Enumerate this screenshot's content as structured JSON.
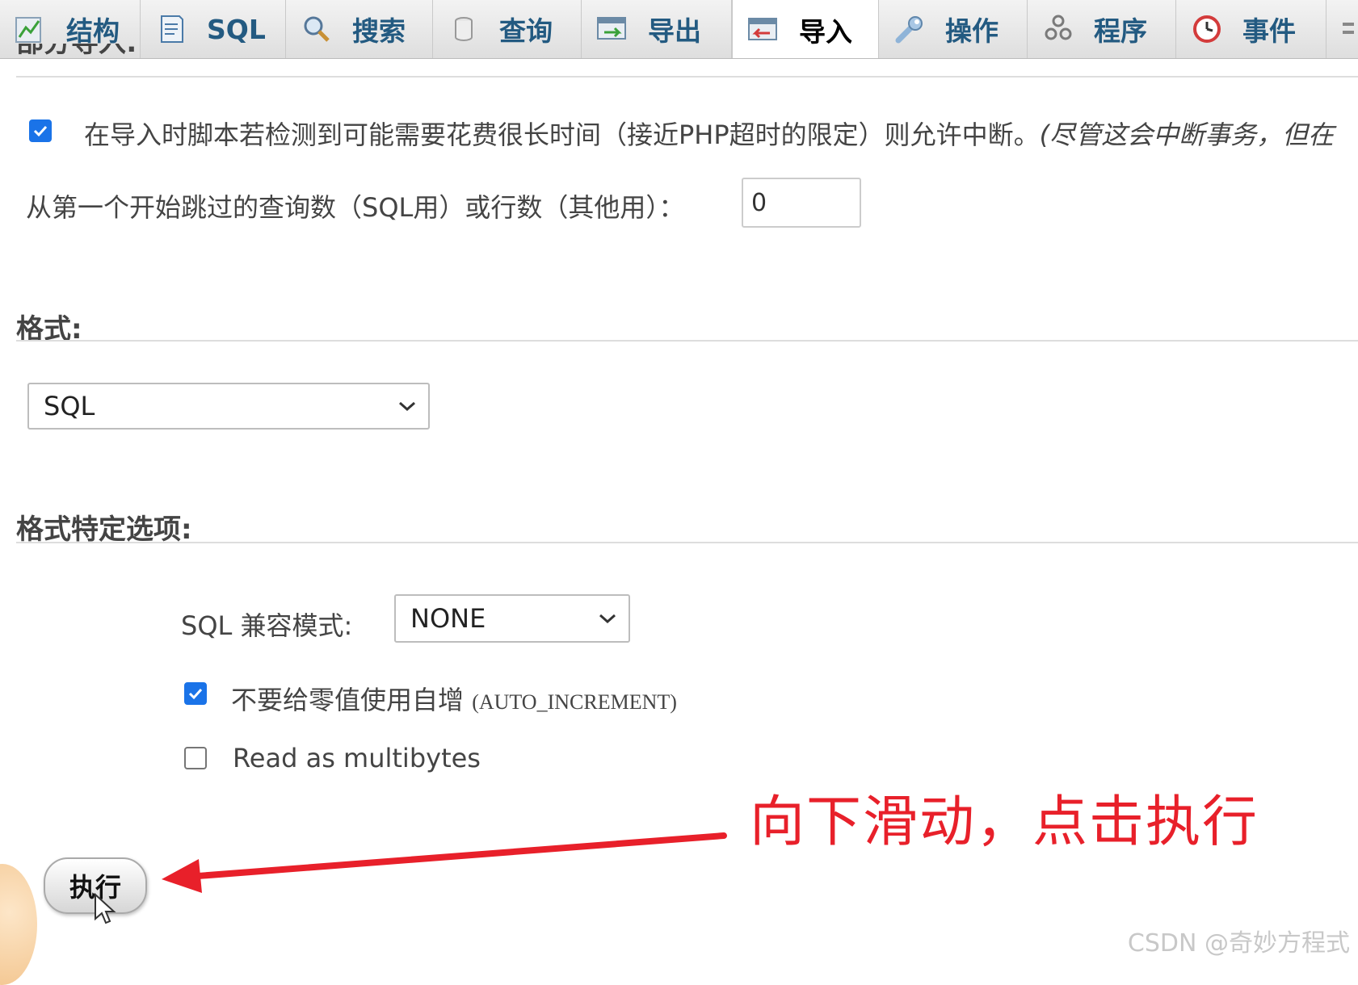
{
  "tabs": [
    {
      "label": "结构",
      "icon": "structure-icon"
    },
    {
      "label": "SQL",
      "icon": "sql-icon"
    },
    {
      "label": "搜索",
      "icon": "search-icon"
    },
    {
      "label": "查询",
      "icon": "query-icon"
    },
    {
      "label": "导出",
      "icon": "export-icon"
    },
    {
      "label": "导入",
      "icon": "import-icon",
      "active": true
    },
    {
      "label": "操作",
      "icon": "wrench-icon"
    },
    {
      "label": "程序",
      "icon": "routines-icon"
    },
    {
      "label": "事件",
      "icon": "clock-icon"
    }
  ],
  "partial_import": {
    "heading_cutoff": "部分导入:",
    "allow_interrupt": {
      "checked": true,
      "label": "在导入时脚本若检测到可能需要花费很长时间（接近PHP超时的限定）则允许中断。",
      "note": "(尽管这会中断事务，但在"
    },
    "skip_queries": {
      "label": "从第一个开始跳过的查询数（SQL用）或行数（其他用）：",
      "value": "0"
    }
  },
  "format": {
    "heading": "格式:",
    "selected": "SQL"
  },
  "format_options": {
    "heading": "格式特定选项:",
    "compat_label": "SQL 兼容模式:",
    "compat_selected": "NONE",
    "no_auto_increment": {
      "checked": true,
      "label": "不要给零值使用自增",
      "code": "(AUTO_INCREMENT)"
    },
    "read_multibytes": {
      "checked": false,
      "label": "Read as multibytes"
    }
  },
  "execute_button": "执行",
  "annotation": "向下滑动，点击执行",
  "watermark": "CSDN @奇妙方程式",
  "colors": {
    "annotation": "#e8202a",
    "checkbox": "#1a73e8",
    "tab_text": "#235a81"
  }
}
